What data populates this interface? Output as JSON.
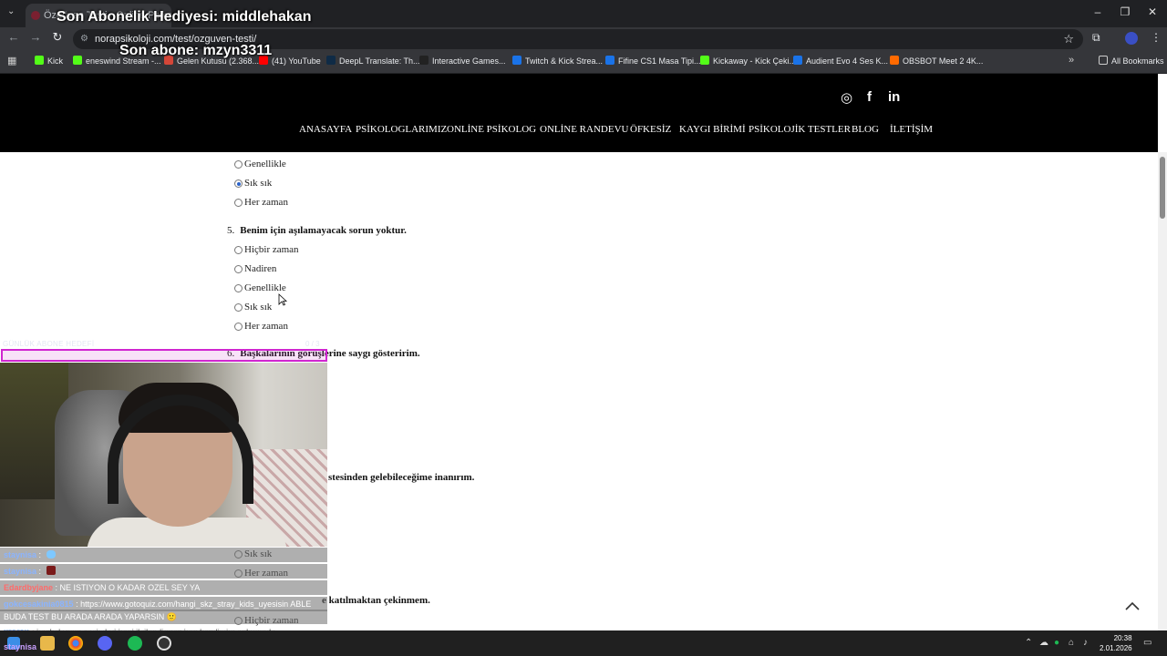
{
  "browser": {
    "tab_title": "Özgüven Testi - Online Psikolog",
    "url": "norapsikoloji.com/test/ozguven-testi/",
    "all_bookmarks": "All Bookmarks",
    "bookmarks": [
      {
        "label": "Kick",
        "color": "#53fc18"
      },
      {
        "label": "eneswind Stream -...",
        "color": "#53fc18"
      },
      {
        "label": "Gelen Kutusu (2.368...",
        "color": "#d44638"
      },
      {
        "label": "(41) YouTube",
        "color": "#ff0000"
      },
      {
        "label": "DeepL Translate: Th...",
        "color": "#0f2b46"
      },
      {
        "label": "Interactive Games...",
        "color": "#222222"
      },
      {
        "label": "Twitch & Kick Strea...",
        "color": "#1a73e8"
      },
      {
        "label": "Fifine CS1 Masa Tipi...",
        "color": "#1a73e8"
      },
      {
        "label": "Kickaway - Kick Çeki...",
        "color": "#53fc18"
      },
      {
        "label": "Audient Evo 4 Ses K...",
        "color": "#1a73e8"
      },
      {
        "label": "OBSBOT Meet 2 4K...",
        "color": "#ff6a00"
      }
    ]
  },
  "overlay": {
    "last_gift": "Son Abonelik Hediyesi: middlehakan",
    "last_sub": "Son abone: mzyn3311",
    "goal_label": "GÜNLÜK ABONE HEDEFİ",
    "goal_count": "0 / 3",
    "goal_progress": 0.0
  },
  "site": {
    "nav": [
      "ANASAYFA",
      "PSİKOLOGLARIMIZ",
      "ONLİNE PSİKOLOG",
      "ONLİNE RANDEVU",
      "ÖFKESİZ",
      "KAYGI BİRİMİ",
      "PSİKOLOJİK TESTLER",
      "BLOG",
      "İLETİŞİM"
    ],
    "social": [
      "instagram-icon",
      "facebook-icon",
      "linkedin-icon"
    ]
  },
  "quiz": {
    "q4_options": [
      {
        "label": "Genellikle",
        "checked": false
      },
      {
        "label": "Sık sık",
        "checked": true
      },
      {
        "label": "Her zaman",
        "checked": false
      }
    ],
    "q5": {
      "number": "5.",
      "text": "Benim için aşılamayacak sorun yoktur.",
      "options": [
        "Hiçbir zaman",
        "Nadiren",
        "Genellikle",
        "Sık sık",
        "Her zaman"
      ]
    },
    "q6": {
      "number": "6.",
      "text": "Başkalarının görüşlerine saygı gösteririm."
    },
    "q7_fragment": "stesinden gelebileceğime inanırım.",
    "q7_options": [
      "Sık sık",
      "Her zaman"
    ],
    "q8_fragment": "e katılmaktan çekinmem.",
    "q8_options": [
      "Hiçbir zaman"
    ]
  },
  "chat": {
    "lines": [
      {
        "user": "staynisa",
        "msg": "",
        "emote": "heart"
      },
      {
        "user": "staynisa",
        "msg": "",
        "emote": "block"
      },
      {
        "user": "Edardbyjane",
        "msg": "NE ISTIYON O KADAR OZEL SEY YA",
        "red": true
      },
      {
        "user": "gokcesakinia0815",
        "msg": "https://www.gotoquiz.com/hangi_skz_stray_kids_uyesisin ABLE"
      },
      {
        "user": "",
        "msg": "BUDA TEST BU ARADA ARADA YAPARSIN 🙂"
      }
    ],
    "last_user": "xrorex",
    "last_msg": "başkalarının seçimleri beni ilgilendirmez ben kendimim anlamında",
    "bottom_user": "staynisa"
  },
  "taskbar": {
    "time": "20:38",
    "date": "2.01.2026"
  }
}
